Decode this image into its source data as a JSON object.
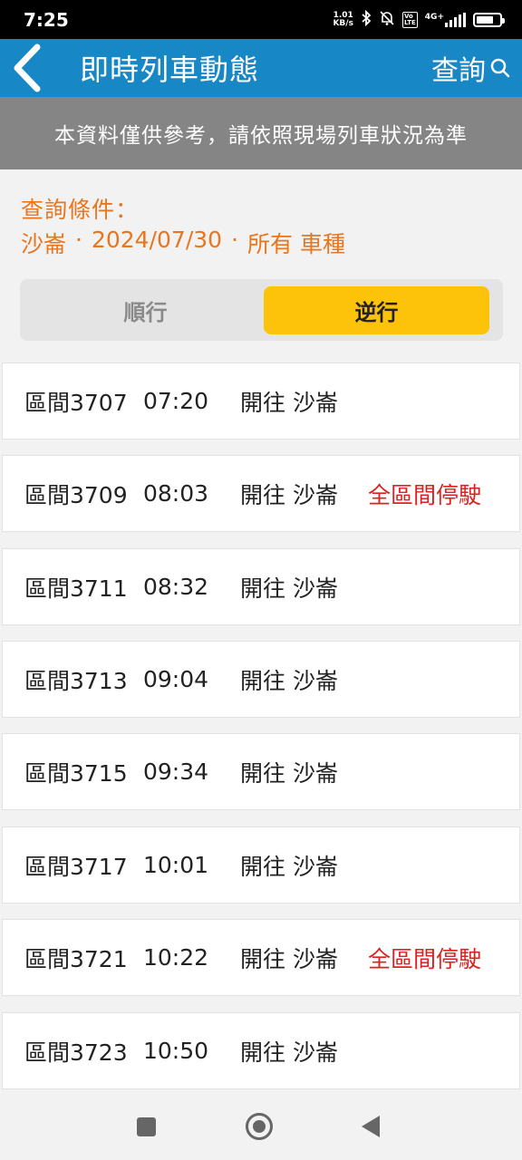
{
  "status_bar": {
    "time": "7:25",
    "net_speed_value": "1.01",
    "net_speed_unit": "KB/s",
    "network": "4G+",
    "volte_label_top": "Vo",
    "volte_label_bottom": "LTE",
    "battery_level": 0.75,
    "icons": [
      "bluetooth-icon",
      "mute-bell-icon",
      "volte-icon",
      "signal-icon",
      "battery-icon"
    ]
  },
  "header": {
    "title": "即時列車動態",
    "search_label": "查詢"
  },
  "notice": {
    "text": "本資料僅供參考，請依照現場列車狀況為準"
  },
  "query": {
    "label": "查詢條件：",
    "station": "沙崙",
    "date": "2024/07/30",
    "train_type": "所有 車種",
    "separator": "·"
  },
  "direction_toggle": {
    "forward_label": "順行",
    "reverse_label": "逆行",
    "selected": "reverse"
  },
  "trains": [
    {
      "name": "區間3707",
      "time": "07:20",
      "destination": "開往 沙崙",
      "status": ""
    },
    {
      "name": "區間3709",
      "time": "08:03",
      "destination": "開往 沙崙",
      "status": "全區間停駛"
    },
    {
      "name": "區間3711",
      "time": "08:32",
      "destination": "開往 沙崙",
      "status": ""
    },
    {
      "name": "區間3713",
      "time": "09:04",
      "destination": "開往 沙崙",
      "status": ""
    },
    {
      "name": "區間3715",
      "time": "09:34",
      "destination": "開往 沙崙",
      "status": ""
    },
    {
      "name": "區間3717",
      "time": "10:01",
      "destination": "開往 沙崙",
      "status": ""
    },
    {
      "name": "區間3721",
      "time": "10:22",
      "destination": "開往 沙崙",
      "status": "全區間停駛"
    },
    {
      "name": "區間3723",
      "time": "10:50",
      "destination": "開往 沙崙",
      "status": ""
    }
  ],
  "colors": {
    "header_bg": "#1787c5",
    "notice_bg": "#858585",
    "query_text": "#e8761f",
    "toggle_active": "#fdc20a",
    "status_alert": "#e02020"
  }
}
